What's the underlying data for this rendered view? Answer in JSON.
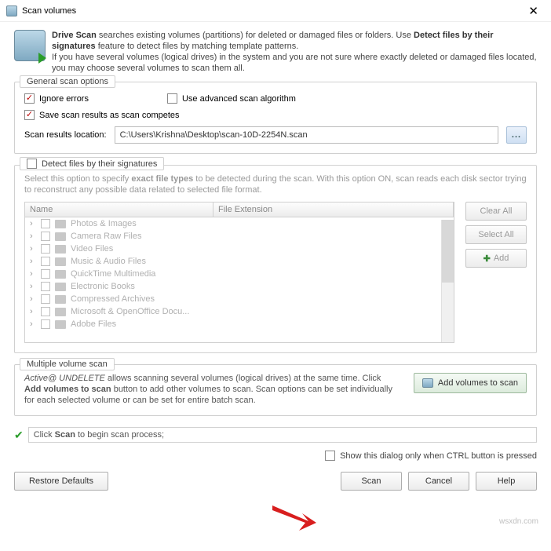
{
  "title": "Scan volumes",
  "intro": {
    "line1a": "Drive Scan",
    "line1b": " searches existing volumes (partitions) for deleted or damaged files or folders. Use ",
    "line1c": "Detect files by their signatures",
    "line1d": " feature to detect files by matching template patterns.",
    "line2": "If you have several volumes (logical drives) in the system and you are not sure where exactly deleted or damaged files located, you may choose several volumes to scan them all."
  },
  "general": {
    "legend": "General scan options",
    "ignore_errors": "Ignore errors",
    "use_advanced": "Use advanced scan algorithm",
    "save_results": "Save scan results as scan competes",
    "location_label": "Scan results location:",
    "location_value": "C:\\Users\\Krishna\\Desktop\\scan-10D-2254N.scan",
    "browse": "..."
  },
  "detect": {
    "legend": "Detect files by their signatures",
    "help1": "Select this option to specify ",
    "help1b": "exact file types",
    "help1c": " to be detected during the scan. With this option ON, scan reads each disk sector trying to reconstruct any possible data related to selected file format.",
    "col1": "Name",
    "col2": "File Extension",
    "rows": [
      "Photos & Images",
      "Camera Raw Files",
      "Video Files",
      "Music & Audio Files",
      "QuickTime Multimedia",
      "Electronic Books",
      "Compressed Archives",
      "Microsoft & OpenOffice Docu...",
      "Adobe Files"
    ],
    "clear_all": "Clear All",
    "select_all": "Select All",
    "add": "Add"
  },
  "mvs": {
    "legend": "Multiple volume scan",
    "text1": "Active@ UNDELETE",
    "text2": " allows scanning several volumes (logical drives) at the same time. Click ",
    "text3": "Add volumes to scan",
    "text4": " button to add other volumes to scan. Scan options can be set individually for each selected volume or can be set for entire batch scan.",
    "addvol": "Add volumes to scan"
  },
  "status": {
    "text1": "Click ",
    "text2": "Scan",
    "text3": " to begin scan process;"
  },
  "show_only": "Show this dialog only when CTRL button is pressed",
  "buttons": {
    "restore": "Restore Defaults",
    "scan": "Scan",
    "cancel": "Cancel",
    "help": "Help"
  },
  "watermark": "wsxdn.com"
}
